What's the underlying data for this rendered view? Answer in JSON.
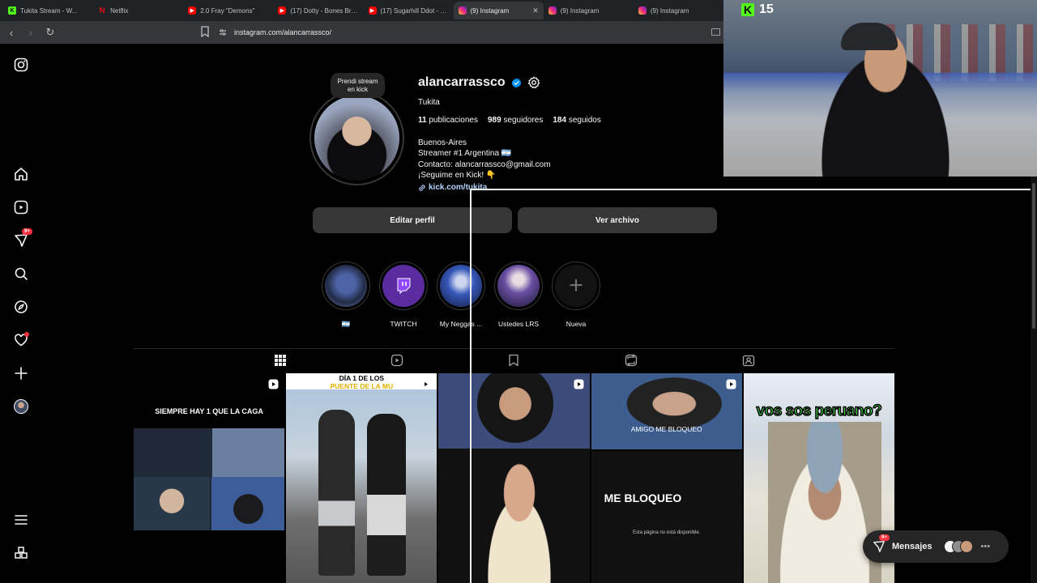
{
  "browser": {
    "tabs": [
      {
        "label": "Tukita Stream - W...",
        "favicon": "kick",
        "active": false
      },
      {
        "label": "Netflix",
        "favicon": "netflix",
        "active": false
      },
      {
        "label": "2.0 Fray \"Demons\"",
        "favicon": "youtube",
        "active": false
      },
      {
        "label": "(17) Dotty - Bones Bre...",
        "favicon": "youtube",
        "active": false
      },
      {
        "label": "(17) Sugarhill Ddot - E...",
        "favicon": "youtube",
        "active": false
      },
      {
        "label": "(9) Instagram",
        "favicon": "instagram",
        "active": true
      },
      {
        "label": "(9) Instagram",
        "favicon": "instagram",
        "active": false
      },
      {
        "label": "(9) Instagram",
        "favicon": "instagram",
        "active": false
      }
    ],
    "url": "instagram.com/alancarrassco/"
  },
  "stream": {
    "viewers": "15"
  },
  "nav": {
    "notifications_badge": "9+"
  },
  "profile": {
    "note": "Prendi stream en kick",
    "username": "alancarrassco",
    "full_name": "Tukita",
    "stats": {
      "posts": "11",
      "posts_label": "publicaciones",
      "followers": "989",
      "followers_label": "seguidores",
      "following": "184",
      "following_label": "seguidos"
    },
    "bio": {
      "line1": "Buenos-Aires",
      "line2": "Streamer #1 Argentina 🇦🇷",
      "line3": "Contacto: alancarrassco@gmail.com",
      "line4": "¡Seguime en Kick! 👇"
    },
    "link": "kick.com/tukita",
    "edit_label": "Editar perfil",
    "archive_label": "Ver archivo"
  },
  "highlights": [
    {
      "label": "🇦🇷"
    },
    {
      "label": "TWITCH"
    },
    {
      "label": "My Neggas ..."
    },
    {
      "label": "Ustedes LRS"
    },
    {
      "label": "Nueva"
    }
  ],
  "posts": [
    {
      "caption": "SIEMPRE HAY 1 QUE LA CAGA",
      "reel": true
    },
    {
      "caption": "DÍA 1 DE LOS",
      "caption2": "PUENTE DE LA MU",
      "reel": true
    },
    {
      "caption": "",
      "reel": true
    },
    {
      "caption": "AMIGO ME BLOQUEO",
      "caption2": "ME BLOQUEO",
      "caption3": "Esta página no está disponible.",
      "reel": true
    },
    {
      "caption": "vos sos peruano?",
      "reel": false
    }
  ],
  "messages": {
    "label": "Mensajes",
    "badge": "9+"
  },
  "colors": {
    "background": "#000000",
    "button": "#363636",
    "accent_red": "#ff3040",
    "verified_blue": "#0095f6",
    "kick_green": "#53fc18"
  }
}
